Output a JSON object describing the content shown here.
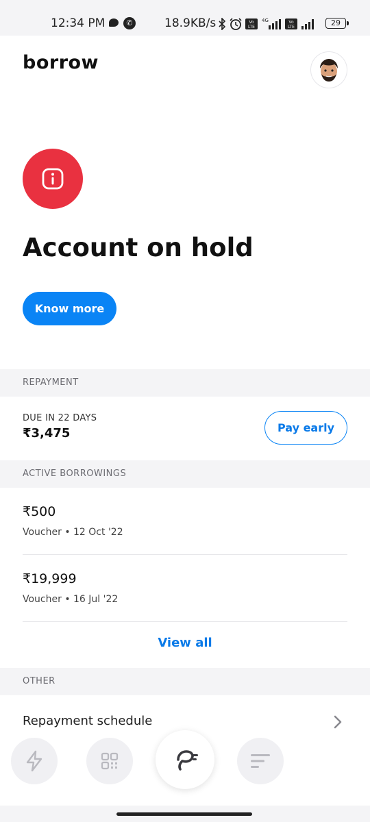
{
  "status_bar": {
    "time": "12:34 PM",
    "speed": "18.9KB/s",
    "battery": "29",
    "network": "4G"
  },
  "header": {
    "title": "borrow",
    "avatar_icon": "memoji-avatar-icon"
  },
  "hero": {
    "icon": "info-icon",
    "title": "Account on hold",
    "cta_label": "Know more",
    "accent_color": "#e93140"
  },
  "repayment": {
    "section_label": "REPAYMENT",
    "due_label": "DUE IN 22 DAYS",
    "due_amount": "₹3,475",
    "pay_label": "Pay early"
  },
  "borrowings": {
    "section_label": "ACTIVE BORROWINGS",
    "items": [
      {
        "amount": "₹500",
        "meta": "Voucher • 12 Oct '22"
      },
      {
        "amount": "₹19,999",
        "meta": "Voucher • 16 Jul '22"
      }
    ],
    "view_all_label": "View all"
  },
  "other": {
    "section_label": "OTHER",
    "items": [
      {
        "label": "Repayment schedule"
      }
    ]
  },
  "bottom_nav": {
    "items": [
      {
        "icon": "lightning-icon"
      },
      {
        "icon": "qr-code-icon"
      },
      {
        "icon": "borrow-logo-icon",
        "active": true
      },
      {
        "icon": "menu-lines-icon"
      }
    ]
  },
  "colors": {
    "primary": "#0a84f5",
    "danger": "#e93140",
    "section_bg": "#f4f4f6"
  }
}
